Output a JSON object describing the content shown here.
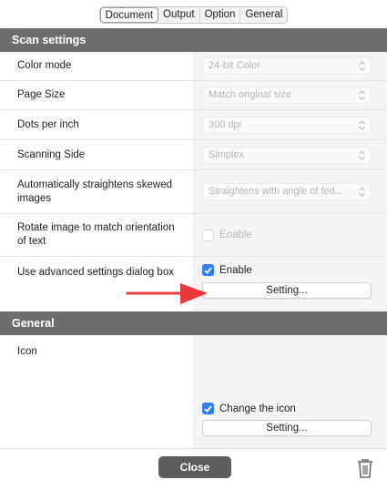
{
  "tabs": [
    {
      "label": "Document",
      "active": true
    },
    {
      "label": "Output",
      "active": false
    },
    {
      "label": "Option",
      "active": false
    },
    {
      "label": "General",
      "active": false
    }
  ],
  "scan_settings": {
    "title": "Scan settings",
    "color_mode": {
      "label": "Color mode",
      "value": "24-bit Color"
    },
    "page_size": {
      "label": "Page Size",
      "value": "Match original size"
    },
    "dpi": {
      "label": "Dots per inch",
      "value": "300 dpi"
    },
    "scanning_side": {
      "label": "Scanning Side",
      "value": "Simplex"
    },
    "straighten": {
      "label": "Automatically straightens skewed images",
      "value": "Straightens with angle of fed..."
    },
    "rotate": {
      "label": "Rotate image to match orientation of text",
      "checkbox_label": "Enable",
      "checked": false
    },
    "advanced": {
      "label": "Use advanced settings dialog box",
      "checkbox_label": "Enable",
      "checked": true,
      "button": "Setting..."
    }
  },
  "general": {
    "title": "General",
    "icon": {
      "label": "Icon",
      "checkbox_label": "Change the icon",
      "checked": true,
      "button": "Setting..."
    }
  },
  "footer": {
    "close_label": "Close"
  },
  "colors": {
    "section_header": "#6e6e6e",
    "checkbox_accent": "#2f7ff6",
    "annotation_arrow": "#e8393d"
  }
}
